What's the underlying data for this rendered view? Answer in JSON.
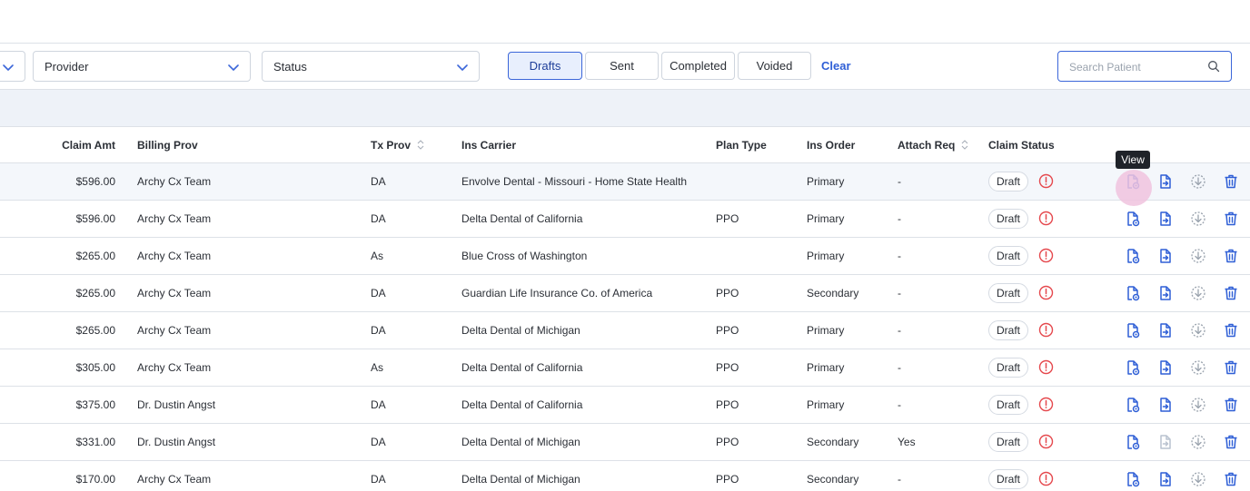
{
  "filters": {
    "provider_label": "Provider",
    "status_label": "Status",
    "tabs": [
      {
        "label": "Drafts",
        "active": true
      },
      {
        "label": "Sent",
        "active": false
      },
      {
        "label": "Completed",
        "active": false
      },
      {
        "label": "Voided",
        "active": false
      }
    ],
    "clear_label": "Clear",
    "search_placeholder": "Search Patient"
  },
  "columns": {
    "claim_amt": "Claim Amt",
    "billing_prov": "Billing Prov",
    "tx_prov": "Tx Prov",
    "ins_carrier": "Ins Carrier",
    "plan_type": "Plan Type",
    "ins_order": "Ins Order",
    "attach_req": "Attach Req",
    "claim_status": "Claim Status"
  },
  "tooltip": "View",
  "colors": {
    "accent": "#2f5fd6",
    "alert": "#e5484d",
    "muted_icon": "#9aa3ae"
  },
  "rows": [
    {
      "claim_amt": "$596.00",
      "billing_prov": "Archy Cx Team",
      "tx_prov": "DA",
      "ins_carrier": "Envolve Dental - Missouri - Home State Health",
      "plan_type": "",
      "ins_order": "Primary",
      "attach_req": "-",
      "claim_status": "Draft",
      "send_enabled": true
    },
    {
      "claim_amt": "$596.00",
      "billing_prov": "Archy Cx Team",
      "tx_prov": "DA",
      "ins_carrier": "Delta Dental of California",
      "plan_type": "PPO",
      "ins_order": "Primary",
      "attach_req": "-",
      "claim_status": "Draft",
      "send_enabled": true
    },
    {
      "claim_amt": "$265.00",
      "billing_prov": "Archy Cx Team",
      "tx_prov": "As",
      "ins_carrier": "Blue Cross of Washington",
      "plan_type": "",
      "ins_order": "Primary",
      "attach_req": "-",
      "claim_status": "Draft",
      "send_enabled": true
    },
    {
      "claim_amt": "$265.00",
      "billing_prov": "Archy Cx Team",
      "tx_prov": "DA",
      "ins_carrier": "Guardian Life Insurance Co. of America",
      "plan_type": "PPO",
      "ins_order": "Secondary",
      "attach_req": "-",
      "claim_status": "Draft",
      "send_enabled": true
    },
    {
      "claim_amt": "$265.00",
      "billing_prov": "Archy Cx Team",
      "tx_prov": "DA",
      "ins_carrier": "Delta Dental of Michigan",
      "plan_type": "PPO",
      "ins_order": "Primary",
      "attach_req": "-",
      "claim_status": "Draft",
      "send_enabled": true
    },
    {
      "claim_amt": "$305.00",
      "billing_prov": "Archy Cx Team",
      "tx_prov": "As",
      "ins_carrier": "Delta Dental of California",
      "plan_type": "PPO",
      "ins_order": "Primary",
      "attach_req": "-",
      "claim_status": "Draft",
      "send_enabled": true
    },
    {
      "claim_amt": "$375.00",
      "billing_prov": "Dr. Dustin Angst",
      "tx_prov": "DA",
      "ins_carrier": "Delta Dental of California",
      "plan_type": "PPO",
      "ins_order": "Primary",
      "attach_req": "-",
      "claim_status": "Draft",
      "send_enabled": true
    },
    {
      "claim_amt": "$331.00",
      "billing_prov": "Dr. Dustin Angst",
      "tx_prov": "DA",
      "ins_carrier": "Delta Dental of Michigan",
      "plan_type": "PPO",
      "ins_order": "Secondary",
      "attach_req": "Yes",
      "claim_status": "Draft",
      "send_enabled": false
    },
    {
      "claim_amt": "$170.00",
      "billing_prov": "Archy Cx Team",
      "tx_prov": "DA",
      "ins_carrier": "Delta Dental of Michigan",
      "plan_type": "PPO",
      "ins_order": "Secondary",
      "attach_req": "-",
      "claim_status": "Draft",
      "send_enabled": true
    }
  ]
}
